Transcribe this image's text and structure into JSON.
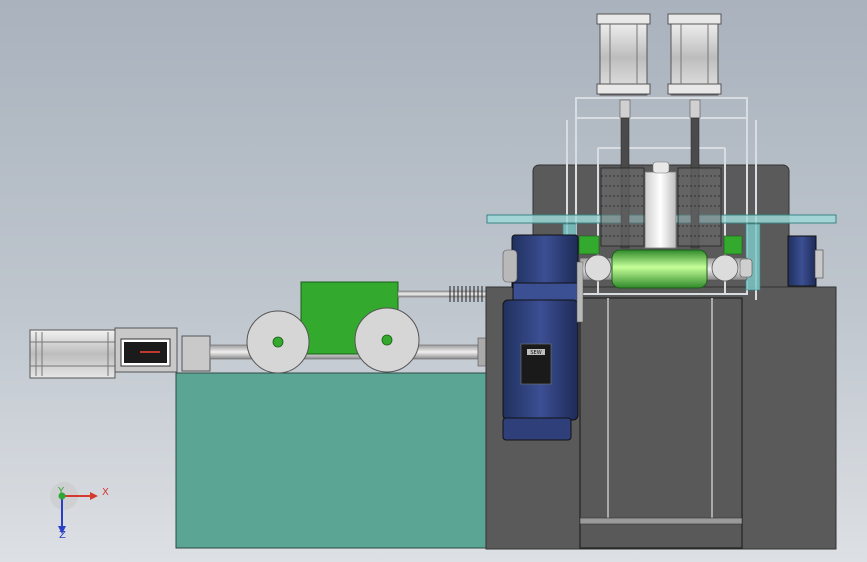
{
  "viewport": {
    "background_colors": [
      "#a9b2bd",
      "#dde0e4"
    ]
  },
  "model": {
    "colors": {
      "tank": "#5ba594",
      "machine_body": "#5a5a5a",
      "gear_motor": "#2f3f7a",
      "green_parts": "#33a92d",
      "glass_plate": "#9fd8d8",
      "frame": "#cfd4d9"
    },
    "motor_label": "SEW"
  },
  "triad": {
    "x_label": "X",
    "y_label": "Y",
    "z_label": "Z",
    "x_color": "#d63a2f",
    "y_color": "#2fa83a",
    "z_color": "#2a3fc8"
  }
}
